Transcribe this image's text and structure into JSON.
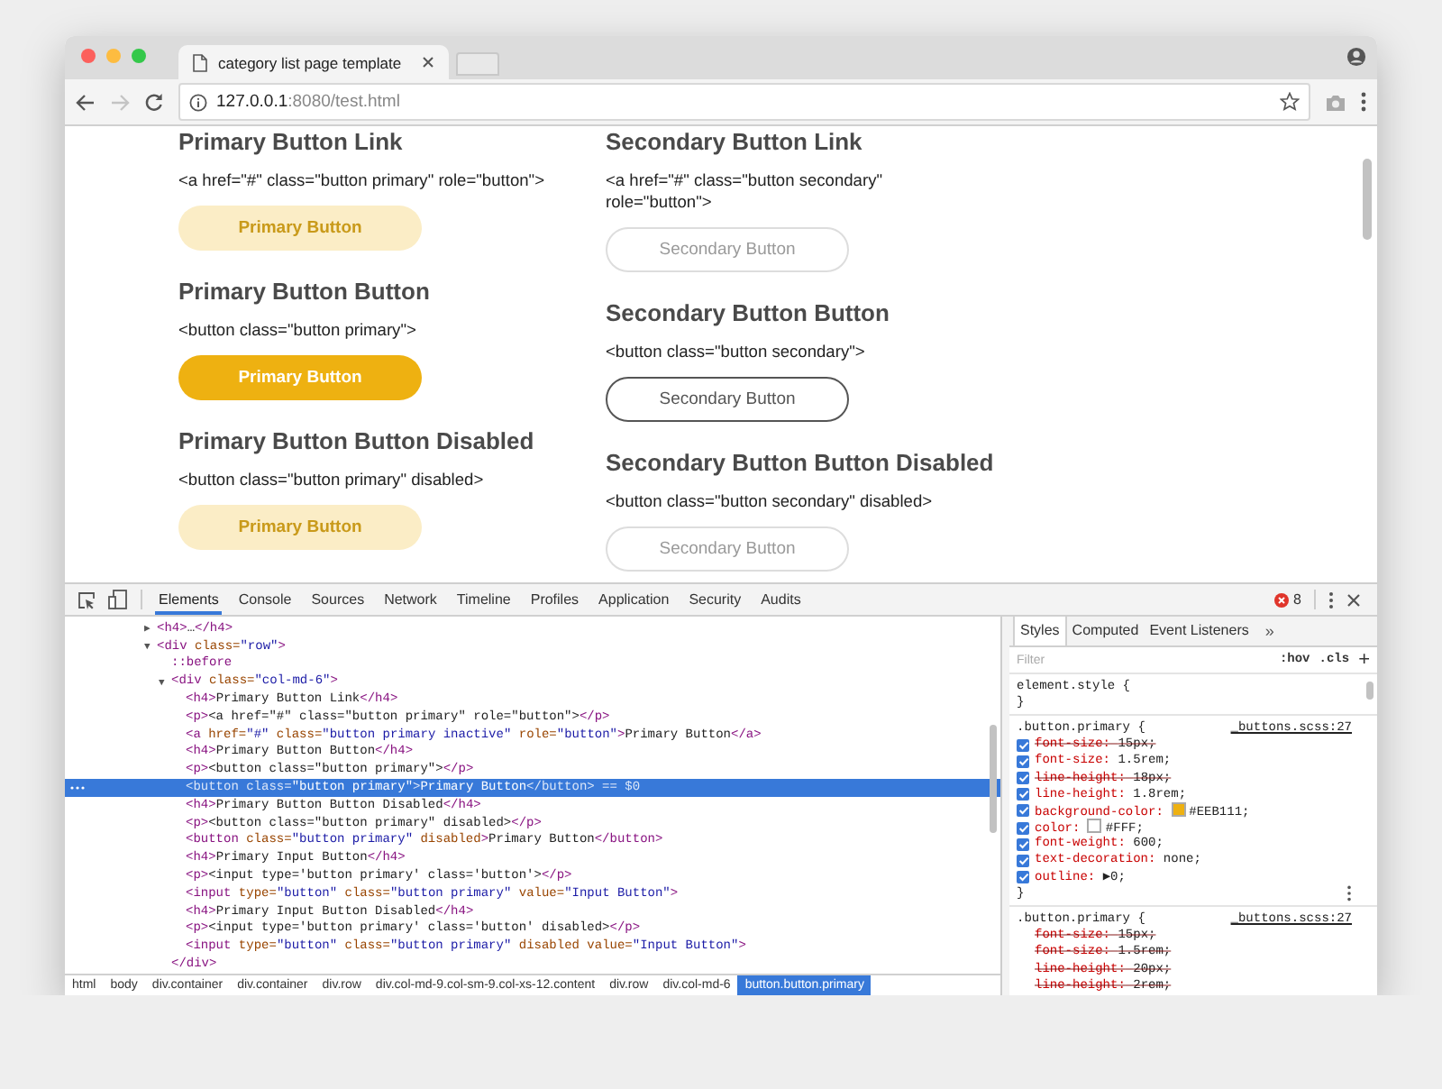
{
  "browser": {
    "tab_title": "category list page template",
    "url_host": "127.0.0.1",
    "url_rest": ":8080/test.html"
  },
  "page": {
    "columns": [
      {
        "sections": [
          {
            "heading": "Primary Button Link",
            "lines": [
              "<a href=\"#\" class=\"button primary\" role=\"button\">"
            ],
            "button": {
              "kind": "primary",
              "label": "Primary Button",
              "disabled": true
            }
          },
          {
            "heading": "Primary Button Button",
            "lines": [
              "<button class=\"button primary\">"
            ],
            "button": {
              "kind": "primary",
              "label": "Primary Button",
              "disabled": false
            }
          },
          {
            "heading": "Primary Button Button Disabled",
            "lines": [
              "<button class=\"button primary\" disabled>"
            ],
            "button": {
              "kind": "primary",
              "label": "Primary Button",
              "disabled": true
            }
          }
        ]
      },
      {
        "sections": [
          {
            "heading": "Secondary Button Link",
            "lines": [
              "<a href=\"#\" class=\"button secondary\"",
              "role=\"button\">"
            ],
            "button": {
              "kind": "secondary",
              "label": "Secondary Button",
              "disabled": true
            }
          },
          {
            "heading": "Secondary Button Button",
            "lines": [
              "<button class=\"button secondary\">"
            ],
            "button": {
              "kind": "secondary",
              "label": "Secondary Button",
              "disabled": false
            }
          },
          {
            "heading": "Secondary Button Button Disabled",
            "lines": [
              "<button class=\"button secondary\" disabled>"
            ],
            "button": {
              "kind": "secondary",
              "label": "Secondary Button",
              "disabled": true
            }
          }
        ]
      }
    ]
  },
  "devtools": {
    "tabs": [
      {
        "label": "Elements",
        "selected": true
      },
      {
        "label": "Console",
        "selected": false
      },
      {
        "label": "Sources",
        "selected": false
      },
      {
        "label": "Network",
        "selected": false
      },
      {
        "label": "Timeline",
        "selected": false
      },
      {
        "label": "Profiles",
        "selected": false
      },
      {
        "label": "Application",
        "selected": false
      },
      {
        "label": "Security",
        "selected": false
      },
      {
        "label": "Audits",
        "selected": false
      }
    ],
    "error_count": "8",
    "elements": {
      "nodes": [
        {
          "toggle": "▶",
          "selected": false,
          "parts": [
            {
              "kind": "tag",
              "text": "<h4>"
            },
            {
              "kind": "text",
              "text": "…"
            },
            {
              "kind": "tag",
              "text": "</h4>"
            }
          ]
        },
        {
          "toggle": "▼",
          "selected": false,
          "parts": [
            {
              "kind": "tag",
              "text": "<div"
            },
            {
              "kind": "attr",
              "text": " class="
            },
            {
              "kind": "val",
              "text": "\"row\""
            },
            {
              "kind": "tag",
              "text": ">"
            }
          ],
          "children": [
            {
              "selected": false,
              "parts": [
                {
                  "kind": "pseudo",
                  "text": "::before"
                }
              ]
            },
            {
              "toggle": "▼",
              "selected": false,
              "parts": [
                {
                  "kind": "tag",
                  "text": "<div"
                },
                {
                  "kind": "attr",
                  "text": " class="
                },
                {
                  "kind": "val",
                  "text": "\"col-md-6\""
                },
                {
                  "kind": "tag",
                  "text": ">"
                }
              ],
              "closing": [
                {
                  "kind": "tag",
                  "text": "</div>"
                }
              ],
              "children": [
                {
                  "selected": false,
                  "parts": [
                    {
                      "kind": "tag",
                      "text": "<h4>"
                    },
                    {
                      "kind": "text",
                      "text": "Primary Button Link"
                    },
                    {
                      "kind": "tag",
                      "text": "</h4>"
                    }
                  ]
                },
                {
                  "selected": false,
                  "parts": [
                    {
                      "kind": "tag",
                      "text": "<p>"
                    },
                    {
                      "kind": "text",
                      "text": "<a href=\"#\" class=\"button primary\" role=\"button\">"
                    },
                    {
                      "kind": "tag",
                      "text": "</p>"
                    }
                  ]
                },
                {
                  "selected": false,
                  "parts": [
                    {
                      "kind": "tag",
                      "text": "<a"
                    },
                    {
                      "kind": "attr",
                      "text": " href="
                    },
                    {
                      "kind": "val",
                      "text": "\"#\""
                    },
                    {
                      "kind": "attr",
                      "text": " class="
                    },
                    {
                      "kind": "val",
                      "text": "\"button primary inactive\""
                    },
                    {
                      "kind": "attr",
                      "text": " role="
                    },
                    {
                      "kind": "val",
                      "text": "\"button\""
                    },
                    {
                      "kind": "tag",
                      "text": ">"
                    },
                    {
                      "kind": "text",
                      "text": "Primary Button"
                    },
                    {
                      "kind": "tag",
                      "text": "</a>"
                    }
                  ]
                },
                {
                  "selected": false,
                  "parts": [
                    {
                      "kind": "tag",
                      "text": "<h4>"
                    },
                    {
                      "kind": "text",
                      "text": "Primary Button Button"
                    },
                    {
                      "kind": "tag",
                      "text": "</h4>"
                    }
                  ]
                },
                {
                  "selected": false,
                  "parts": [
                    {
                      "kind": "tag",
                      "text": "<p>"
                    },
                    {
                      "kind": "text",
                      "text": "<button class=\"button primary\">"
                    },
                    {
                      "kind": "tag",
                      "text": "</p>"
                    }
                  ]
                },
                {
                  "selected": true,
                  "parts": [
                    {
                      "kind": "tag",
                      "text": "<button"
                    },
                    {
                      "kind": "attr",
                      "text": " class="
                    },
                    {
                      "kind": "val",
                      "text": "\"button primary\""
                    },
                    {
                      "kind": "tag",
                      "text": ">"
                    },
                    {
                      "kind": "text",
                      "text": "Primary Button"
                    },
                    {
                      "kind": "tag",
                      "text": "</button>"
                    },
                    {
                      "kind": "dim",
                      "text": " == $0"
                    }
                  ]
                },
                {
                  "selected": false,
                  "parts": [
                    {
                      "kind": "tag",
                      "text": "<h4>"
                    },
                    {
                      "kind": "text",
                      "text": "Primary Button Button Disabled"
                    },
                    {
                      "kind": "tag",
                      "text": "</h4>"
                    }
                  ]
                },
                {
                  "selected": false,
                  "parts": [
                    {
                      "kind": "tag",
                      "text": "<p>"
                    },
                    {
                      "kind": "text",
                      "text": "<button class=\"button primary\" disabled>"
                    },
                    {
                      "kind": "tag",
                      "text": "</p>"
                    }
                  ]
                },
                {
                  "selected": false,
                  "parts": [
                    {
                      "kind": "tag",
                      "text": "<button"
                    },
                    {
                      "kind": "attr",
                      "text": " class="
                    },
                    {
                      "kind": "val",
                      "text": "\"button primary\""
                    },
                    {
                      "kind": "attr",
                      "text": " disabled"
                    },
                    {
                      "kind": "tag",
                      "text": ">"
                    },
                    {
                      "kind": "text",
                      "text": "Primary Button"
                    },
                    {
                      "kind": "tag",
                      "text": "</button>"
                    }
                  ]
                },
                {
                  "selected": false,
                  "parts": [
                    {
                      "kind": "tag",
                      "text": "<h4>"
                    },
                    {
                      "kind": "text",
                      "text": "Primary Input Button"
                    },
                    {
                      "kind": "tag",
                      "text": "</h4>"
                    }
                  ]
                },
                {
                  "selected": false,
                  "parts": [
                    {
                      "kind": "tag",
                      "text": "<p>"
                    },
                    {
                      "kind": "text",
                      "text": "<input type='button primary' class='button'>"
                    },
                    {
                      "kind": "tag",
                      "text": "</p>"
                    }
                  ]
                },
                {
                  "selected": false,
                  "parts": [
                    {
                      "kind": "tag",
                      "text": "<input"
                    },
                    {
                      "kind": "attr",
                      "text": " type="
                    },
                    {
                      "kind": "val",
                      "text": "\"button\""
                    },
                    {
                      "kind": "attr",
                      "text": " class="
                    },
                    {
                      "kind": "val",
                      "text": "\"button primary\""
                    },
                    {
                      "kind": "attr",
                      "text": " value="
                    },
                    {
                      "kind": "val",
                      "text": "\"Input Button\""
                    },
                    {
                      "kind": "tag",
                      "text": ">"
                    }
                  ]
                },
                {
                  "selected": false,
                  "parts": [
                    {
                      "kind": "tag",
                      "text": "<h4>"
                    },
                    {
                      "kind": "text",
                      "text": "Primary Input Button Disabled"
                    },
                    {
                      "kind": "tag",
                      "text": "</h4>"
                    }
                  ]
                },
                {
                  "selected": false,
                  "parts": [
                    {
                      "kind": "tag",
                      "text": "<p>"
                    },
                    {
                      "kind": "text",
                      "text": "<input type='button primary' class='button' disabled>"
                    },
                    {
                      "kind": "tag",
                      "text": "</p>"
                    }
                  ]
                },
                {
                  "selected": false,
                  "parts": [
                    {
                      "kind": "tag",
                      "text": "<input"
                    },
                    {
                      "kind": "attr",
                      "text": " type="
                    },
                    {
                      "kind": "val",
                      "text": "\"button\""
                    },
                    {
                      "kind": "attr",
                      "text": " class="
                    },
                    {
                      "kind": "val",
                      "text": "\"button primary\""
                    },
                    {
                      "kind": "attr",
                      "text": " disabled value="
                    },
                    {
                      "kind": "val",
                      "text": "\"Input Button\""
                    },
                    {
                      "kind": "tag",
                      "text": ">"
                    }
                  ]
                }
              ]
            }
          ]
        }
      ]
    },
    "breadcrumbs": [
      {
        "label": "html",
        "selected": false
      },
      {
        "label": "body",
        "selected": false
      },
      {
        "label": "div.container",
        "selected": false
      },
      {
        "label": "div.container",
        "selected": false
      },
      {
        "label": "div.row",
        "selected": false
      },
      {
        "label": "div.col-md-9.col-sm-9.col-xs-12.content",
        "selected": false
      },
      {
        "label": "div.row",
        "selected": false
      },
      {
        "label": "div.col-md-6",
        "selected": false
      },
      {
        "label": "button.button.primary",
        "selected": true
      }
    ],
    "styles": {
      "tabs": [
        {
          "label": "Styles",
          "selected": true
        },
        {
          "label": "Computed",
          "selected": false
        },
        {
          "label": "Event Listeners",
          "selected": false
        }
      ],
      "more": "»",
      "filter_placeholder": "Filter",
      "hov": ":hov",
      "cls": ".cls",
      "add": "+",
      "rules": [
        {
          "selector": "element.style {",
          "close": "}"
        },
        {
          "selector": ".button.primary {",
          "source": "_buttons.scss:27",
          "close": "}",
          "show_checkboxes": true,
          "declarations": [
            {
              "name": "font-size:",
              "value": "15px;",
              "struck": true
            },
            {
              "name": "font-size:",
              "value": "1.5rem;",
              "struck": false
            },
            {
              "name": "line-height:",
              "value": "18px;",
              "struck": true
            },
            {
              "name": "line-height:",
              "value": "1.8rem;",
              "struck": false
            },
            {
              "name": "background-color:",
              "value": "#EEB111;",
              "struck": false,
              "color": "#eeb111"
            },
            {
              "name": "color:",
              "value": "#FFF;",
              "struck": false,
              "color": "#ffffff"
            },
            {
              "name": "font-weight:",
              "value": "600;",
              "struck": false
            },
            {
              "name": "text-decoration:",
              "value": "none;",
              "struck": false
            },
            {
              "name": "outline:",
              "value": "▶0;",
              "struck": false
            }
          ]
        },
        {
          "selector": ".button.primary {",
          "source": "_buttons.scss:27",
          "show_checkboxes": false,
          "declarations": [
            {
              "name": "font-size:",
              "value": "15px;",
              "struck": true
            },
            {
              "name": "font-size:",
              "value": "1.5rem;",
              "struck": true
            },
            {
              "name": "line-height:",
              "value": "20px;",
              "struck": true
            },
            {
              "name": "line-height:",
              "value": "2rem;",
              "struck": true
            }
          ]
        }
      ]
    }
  }
}
